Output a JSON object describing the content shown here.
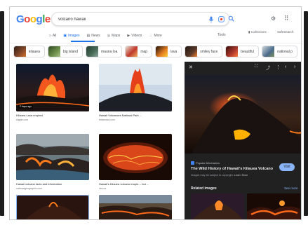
{
  "search": {
    "query": "volcano hawaii"
  },
  "logo": {
    "letters": [
      "G",
      "o",
      "o",
      "g",
      "l",
      "e"
    ],
    "colors": [
      "#4285f4",
      "#ea4335",
      "#fbbc05",
      "#4285f4",
      "#34a853",
      "#ea4335"
    ]
  },
  "tabs": [
    {
      "label": "All",
      "icon": "search-icon",
      "glyph": "⌕",
      "active": false
    },
    {
      "label": "Images",
      "icon": "image-icon",
      "glyph": "▣",
      "active": true
    },
    {
      "label": "News",
      "icon": "news-icon",
      "glyph": "▤",
      "active": false
    },
    {
      "label": "Maps",
      "icon": "map-pin-icon",
      "glyph": "◎",
      "active": false
    },
    {
      "label": "Videos",
      "icon": "video-icon",
      "glyph": "▶",
      "active": false
    },
    {
      "label": "More",
      "icon": "more-icon",
      "glyph": "⋮",
      "active": false
    }
  ],
  "tools_label": "Tools",
  "collections_label": "Collections",
  "safesearch_label": "SafeSearch",
  "chips": [
    {
      "label": "kilauea",
      "color": "#5a3a2a"
    },
    {
      "label": "big island",
      "color": "#3f5b2f"
    },
    {
      "label": "mauna loa",
      "color": "#2e4d3f"
    },
    {
      "label": "map",
      "color": "#c0392b"
    },
    {
      "label": "lava",
      "color": "#e67e22"
    },
    {
      "label": "smiley face",
      "color": "#3a2a22"
    },
    {
      "label": "beautiful",
      "color": "#b03a2e"
    },
    {
      "label": "national p",
      "color": "#4a6a8a"
    }
  ],
  "results": [
    {
      "caption": "Kilauea Lava erupted",
      "source": "sfgate.com",
      "badge": "2 days ago"
    },
    {
      "caption": "Hawaii Volcanoes National Park ...",
      "source": "britannica.com",
      "badge": ""
    },
    {
      "caption": "Hawaii volcano facts and information",
      "source": "nationalgeographic.com",
      "badge": ""
    },
    {
      "caption": "Hawaii's Kilauea volcano erupts -- but ...",
      "source": "cbs.ca",
      "badge": ""
    },
    {
      "caption": "",
      "source": "",
      "badge": ""
    },
    {
      "caption": "",
      "source": "",
      "badge": ""
    }
  ],
  "panel": {
    "publisher": "Popular Mechanics",
    "title": "The Wild History of Hawaii's Kilauea Volcano",
    "note": "Images may be subject to copyright.",
    "learn_more": "Learn More",
    "visit": "Visit",
    "related": "Related images",
    "see_more": "See more"
  },
  "colors": {
    "accent": "#1a73e8",
    "panel_bg": "#212121",
    "lava": "#ff6a00"
  }
}
